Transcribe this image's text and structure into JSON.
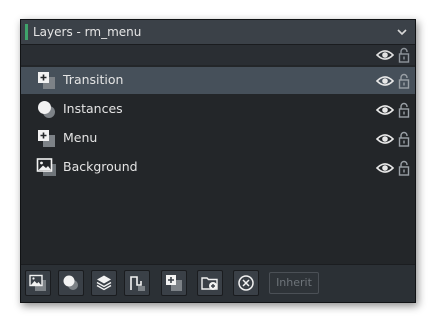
{
  "window": {
    "title": "Layers - rm_menu",
    "accent_color": "#3fa36b",
    "selected_row_color": "#46505a"
  },
  "layers": [
    {
      "name": "Transition",
      "icon": "tile-layer-icon",
      "selected": true
    },
    {
      "name": "Instances",
      "icon": "instance-layer-icon",
      "selected": false
    },
    {
      "name": "Menu",
      "icon": "tile-layer-icon",
      "selected": false
    },
    {
      "name": "Background",
      "icon": "background-layer-icon",
      "selected": false
    }
  ],
  "toolbar": {
    "buttons": [
      "add-background-layer-icon",
      "add-instance-layer-icon",
      "add-asset-layer-icon",
      "add-path-layer-icon",
      "add-tile-layer-icon",
      "add-folder-icon",
      "delete-layer-icon"
    ],
    "inherit_label": "Inherit"
  }
}
